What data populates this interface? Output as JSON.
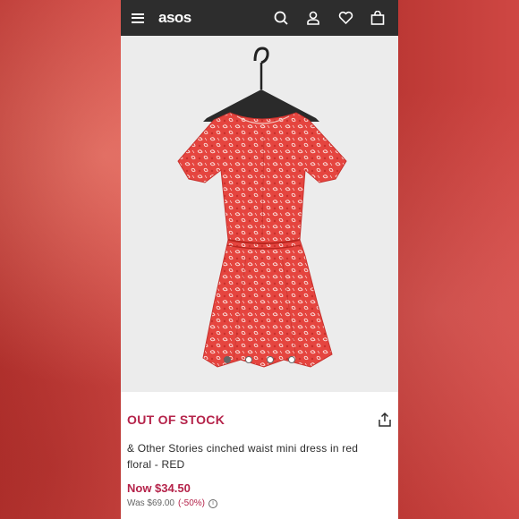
{
  "header": {
    "logo": "asos",
    "icons": [
      "menu-icon",
      "search-icon",
      "account-icon",
      "wishlist-icon",
      "bag-icon"
    ]
  },
  "gallery": {
    "image_count": 4,
    "active_index": 0
  },
  "product": {
    "status": "OUT OF STOCK",
    "title": "& Other Stories cinched waist mini dress in red floral - RED",
    "now_price": "Now $34.50",
    "was_label": "Was $69.00",
    "discount": "(-50%)"
  },
  "colors": {
    "accent": "#b5234a",
    "topbar": "#2d2d2d",
    "dress": "#e5453f"
  }
}
